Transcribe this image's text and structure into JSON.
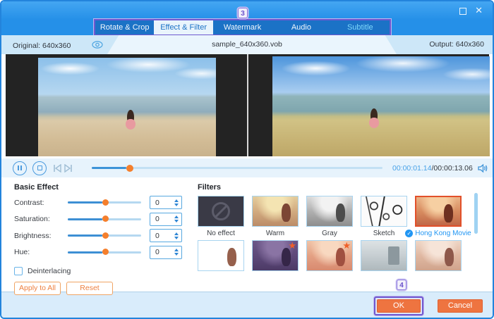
{
  "annotations": {
    "step_3": "3",
    "step_4": "4"
  },
  "icons": {
    "maximize": "maximize-square",
    "close": "✕",
    "preview_eye": "eye-outline",
    "pause": "pause-circle",
    "stop": "stop-circle",
    "prev_frame": "previous-frame",
    "next_frame": "next-frame",
    "volume": "speaker-waves",
    "spin_up": "up-triangle",
    "spin_down": "down-triangle",
    "check": "✓",
    "star": "★",
    "no_effect": "prohibition-circle"
  },
  "tabs": [
    {
      "label": "Rotate & Crop",
      "state": "normal"
    },
    {
      "label": "Effect & Filter",
      "state": "selected"
    },
    {
      "label": "Watermark",
      "state": "normal"
    },
    {
      "label": "Audio",
      "state": "normal"
    },
    {
      "label": "Subtitle",
      "state": "highlight"
    }
  ],
  "info_bar": {
    "original": "Original: 640x360",
    "filename": "sample_640x360.vob",
    "output": "Output: 640x360"
  },
  "player": {
    "current_time": "00:00:01.14",
    "separator": "/",
    "total_time": "00:00:13.06",
    "progress_percent": 12
  },
  "basic_effect": {
    "title": "Basic Effect",
    "rows": [
      {
        "label": "Contrast:",
        "value": "0",
        "slider_percent": 47
      },
      {
        "label": "Saturation:",
        "value": "0",
        "slider_percent": 47
      },
      {
        "label": "Brightness:",
        "value": "0",
        "slider_percent": 47
      },
      {
        "label": "Hue:",
        "value": "0",
        "slider_percent": 47
      }
    ],
    "deinterlacing_label": "Deinterlacing",
    "deinterlacing_checked": false,
    "apply_all_label": "Apply to All",
    "reset_label": "Reset"
  },
  "filters": {
    "title": "Filters",
    "items": [
      {
        "label": "No effect",
        "selected": false,
        "starred": false
      },
      {
        "label": "Warm",
        "selected": false,
        "starred": false
      },
      {
        "label": "Gray",
        "selected": false,
        "starred": false
      },
      {
        "label": "Sketch",
        "selected": false,
        "starred": false
      },
      {
        "label": "Hong Kong Movie",
        "selected": true,
        "starred": false
      },
      {
        "label": "",
        "selected": false,
        "starred": false
      },
      {
        "label": "",
        "selected": false,
        "starred": true
      },
      {
        "label": "",
        "selected": false,
        "starred": true
      },
      {
        "label": "",
        "selected": false,
        "starred": false
      },
      {
        "label": "",
        "selected": false,
        "starred": false
      }
    ]
  },
  "footer": {
    "ok_label": "OK",
    "cancel_label": "Cancel"
  },
  "colors": {
    "titlebar_blue": "#2590e8",
    "tab_strip_blue": "#1b72c6",
    "annotation_purple": "#6e58d0",
    "accent_orange": "#ee7440",
    "slider_thumb_orange": "#f57f2c",
    "selected_filter_border": "#e2502a",
    "time_blue": "#4aa3e8"
  }
}
